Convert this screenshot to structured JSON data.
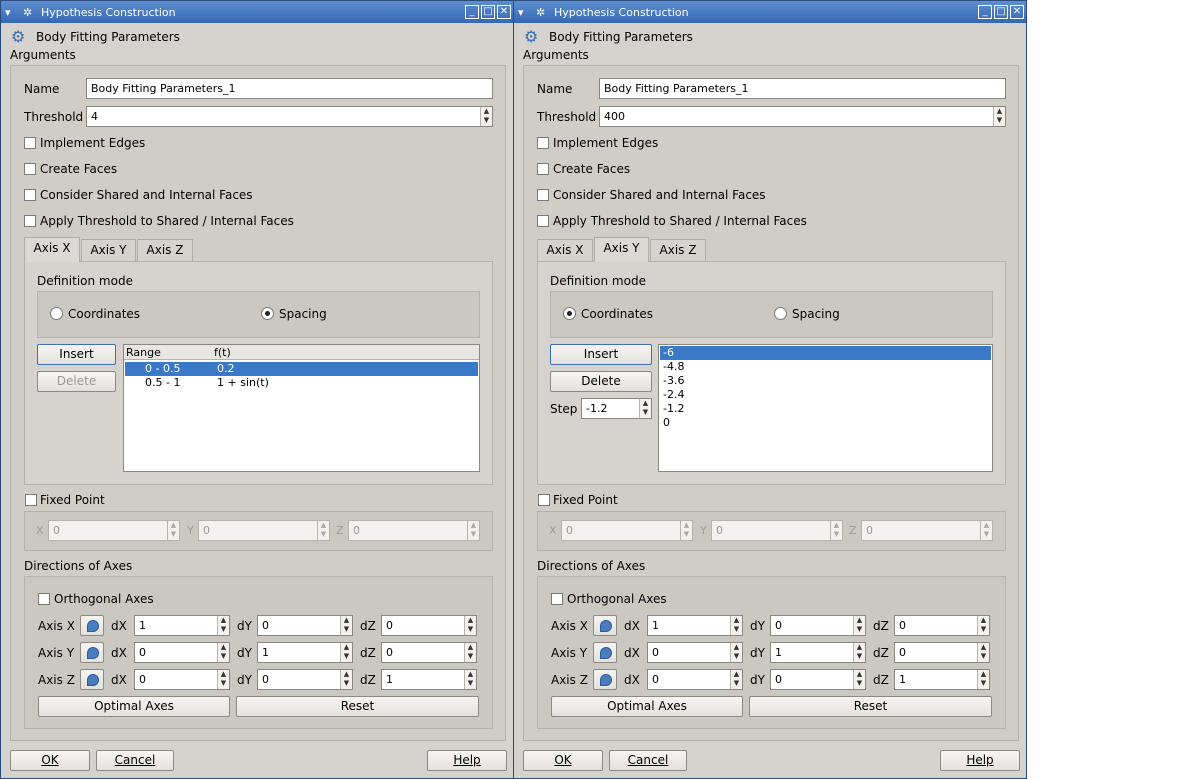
{
  "dialogs": [
    {
      "window_title": "Hypothesis Construction",
      "header": "Body Fitting Parameters",
      "arguments_label": "Arguments",
      "name_label": "Name",
      "name_value": "Body Fitting Parameters_1",
      "threshold_label": "Threshold",
      "threshold_value": "4",
      "checkboxes": [
        "Implement Edges",
        "Create Faces",
        "Consider Shared and Internal Faces",
        "Apply Threshold to Shared / Internal Faces"
      ],
      "tabs": [
        "Axis X",
        "Axis Y",
        "Axis Z"
      ],
      "active_tab": "Axis X",
      "definition_mode_label": "Definition mode",
      "mode_coordinates": "Coordinates",
      "mode_spacing": "Spacing",
      "selected_mode": "Spacing",
      "insert_label": "Insert",
      "delete_label": "Delete",
      "table_headers": [
        "Range",
        "f(t)"
      ],
      "table_rows": [
        [
          "0 - 0.5",
          "0.2"
        ],
        [
          "0.5 - 1",
          "1 + sin(t)"
        ]
      ],
      "fixed_point_label": "Fixed Point",
      "fixed_x_label": "X",
      "fixed_x": "0",
      "fixed_y_label": "Y",
      "fixed_y": "0",
      "fixed_z_label": "Z",
      "fixed_z": "0",
      "directions_label": "Directions of Axes",
      "orthogonal_label": "Orthogonal Axes",
      "axes": [
        {
          "label": "Axis X",
          "dX": "1",
          "dY": "0",
          "dZ": "0"
        },
        {
          "label": "Axis Y",
          "dX": "0",
          "dY": "1",
          "dZ": "0"
        },
        {
          "label": "Axis Z",
          "dX": "0",
          "dY": "0",
          "dZ": "1"
        }
      ],
      "dx_label": "dX",
      "dy_label": "dY",
      "dz_label": "dZ",
      "optimal_axes_label": "Optimal Axes",
      "reset_label": "Reset",
      "ok_label": "OK",
      "cancel_label": "Cancel",
      "help_label": "Help"
    },
    {
      "window_title": "Hypothesis Construction",
      "header": "Body Fitting Parameters",
      "arguments_label": "Arguments",
      "name_label": "Name",
      "name_value": "Body Fitting Parameters_1",
      "threshold_label": "Threshold",
      "threshold_value": "400",
      "checkboxes": [
        "Implement Edges",
        "Create Faces",
        "Consider Shared and Internal Faces",
        "Apply Threshold to Shared / Internal Faces"
      ],
      "tabs": [
        "Axis X",
        "Axis Y",
        "Axis Z"
      ],
      "active_tab": "Axis Y",
      "definition_mode_label": "Definition mode",
      "mode_coordinates": "Coordinates",
      "mode_spacing": "Spacing",
      "selected_mode": "Coordinates",
      "insert_label": "Insert",
      "delete_label": "Delete",
      "step_label": "Step",
      "step_value": "-1.2",
      "coordinates": [
        "-6",
        "-4.8",
        "-3.6",
        "-2.4",
        "-1.2",
        "0"
      ],
      "fixed_point_label": "Fixed Point",
      "fixed_x_label": "X",
      "fixed_x": "0",
      "fixed_y_label": "Y",
      "fixed_y": "0",
      "fixed_z_label": "Z",
      "fixed_z": "0",
      "directions_label": "Directions of Axes",
      "orthogonal_label": "Orthogonal Axes",
      "axes": [
        {
          "label": "Axis X",
          "dX": "1",
          "dY": "0",
          "dZ": "0"
        },
        {
          "label": "Axis Y",
          "dX": "0",
          "dY": "1",
          "dZ": "0"
        },
        {
          "label": "Axis Z",
          "dX": "0",
          "dY": "0",
          "dZ": "1"
        }
      ],
      "dx_label": "dX",
      "dy_label": "dY",
      "dz_label": "dZ",
      "optimal_axes_label": "Optimal Axes",
      "reset_label": "Reset",
      "ok_label": "OK",
      "cancel_label": "Cancel",
      "help_label": "Help"
    }
  ]
}
